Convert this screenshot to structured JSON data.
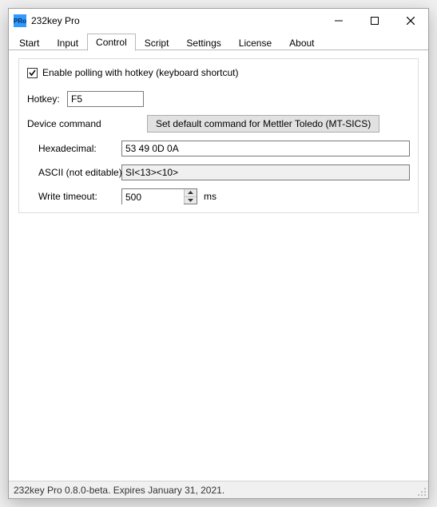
{
  "app_icon_text": "PRo",
  "title": "232key Pro",
  "tabs": {
    "start": "Start",
    "input": "Input",
    "control": "Control",
    "script": "Script",
    "settings": "Settings",
    "license": "License",
    "about": "About"
  },
  "control": {
    "enable_polling_label": "Enable polling with hotkey (keyboard shortcut)",
    "hotkey_label": "Hotkey:",
    "hotkey_value": "F5",
    "device_command_label": "Device command",
    "set_default_button": "Set default command for Mettler Toledo (MT-SICS)",
    "hex_label": "Hexadecimal:",
    "hex_value": "53 49 0D 0A",
    "ascii_label": "ASCII (not editable):",
    "ascii_value": "SI<13><10>",
    "timeout_label": "Write timeout:",
    "timeout_value": "500",
    "timeout_unit": "ms"
  },
  "statusbar": "232key Pro 0.8.0-beta. Expires January 31, 2021."
}
